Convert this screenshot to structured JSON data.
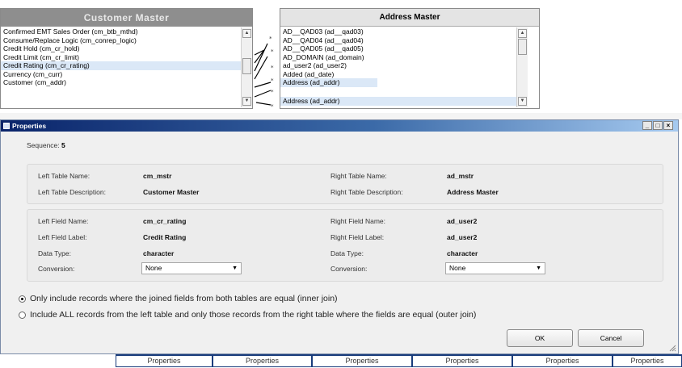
{
  "left_table": {
    "title": "Customer Master",
    "items": [
      "Confirmed EMT Sales Order (cm_btb_mthd)",
      "Consume/Replace Logic (cm_conrep_logic)",
      "Credit Hold (cm_cr_hold)",
      "Credit Limit (cm_cr_limit)",
      "Credit Rating (cm_cr_rating)",
      "Currency (cm_curr)",
      "Customer (cm_addr)"
    ],
    "selected_index": 4
  },
  "right_table": {
    "title": "Address Master",
    "items": [
      "AD__QAD03 (ad__qad03)",
      "AD__QAD04 (ad__qad04)",
      "AD__QAD05 (ad__qad05)",
      "AD_DOMAIN (ad_domain)",
      "ad_user2 (ad_user2)",
      "Added (ad_date)",
      "Address (ad_addr)"
    ],
    "selected_index": 6
  },
  "dialog": {
    "title": "Properties",
    "sequence_label": "Sequence:",
    "sequence_value": "5",
    "left_table_name_label": "Left Table Name:",
    "left_table_name": "cm_mstr",
    "left_table_desc_label": "Left Table Description:",
    "left_table_desc": "Customer Master",
    "right_table_name_label": "Right Table Name:",
    "right_table_name": "ad_mstr",
    "right_table_desc_label": "Right Table Description:",
    "right_table_desc": "Address Master",
    "left_field_name_label": "Left Field Name:",
    "left_field_name": "cm_cr_rating",
    "left_field_label_label": "Left Field Label:",
    "left_field_label": "Credit Rating",
    "left_data_type_label": "Data Type:",
    "left_data_type": "character",
    "left_conversion_label": "Conversion:",
    "left_conversion": "None",
    "right_field_name_label": "Right Field Name:",
    "right_field_name": "ad_user2",
    "right_field_label_label": "Right Field Label:",
    "right_field_label": "ad_user2",
    "right_data_type_label": "Data Type:",
    "right_data_type": "character",
    "right_conversion_label": "Conversion:",
    "right_conversion": "None",
    "radio_inner": "Only include records where the joined fields from both tables are equal (inner join)",
    "radio_outer": "Include ALL records from the left table and only those records from the right table where the fields are equal (outer join)",
    "selected_join": "inner",
    "ok_label": "OK",
    "cancel_label": "Cancel",
    "minimize_glyph": "_",
    "maximize_glyph": "□",
    "close_glyph": "×"
  },
  "tabs": [
    "Properties",
    "Properties",
    "Properties",
    "Properties",
    "Properties",
    "Properties"
  ]
}
